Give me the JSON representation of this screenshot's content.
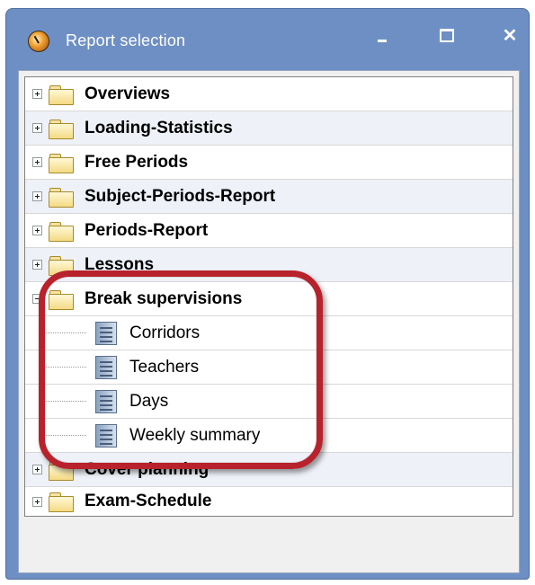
{
  "window": {
    "title": "Report selection",
    "controls": {
      "minimize": "minimize",
      "maximize": "maximize",
      "close": "✕"
    }
  },
  "categories": [
    {
      "label": "Overviews",
      "expanded": false
    },
    {
      "label": "Loading-Statistics",
      "expanded": false
    },
    {
      "label": "Free Periods",
      "expanded": false
    },
    {
      "label": "Subject-Periods-Report",
      "expanded": false
    },
    {
      "label": "Periods-Report",
      "expanded": false
    },
    {
      "label": "Lessons",
      "expanded": false
    },
    {
      "label": "Break supervisions",
      "expanded": true
    },
    {
      "label": "Cover planning",
      "expanded": false
    },
    {
      "label": "Exam-Schedule",
      "expanded": false
    }
  ],
  "break_supervisions_items": [
    {
      "label": "Corridors"
    },
    {
      "label": "Teachers"
    },
    {
      "label": "Days"
    },
    {
      "label": "Weekly summary"
    }
  ],
  "colors": {
    "titlebar": "#6d8fc4",
    "highlight": "#b8222c",
    "folder": "#f4da84"
  }
}
